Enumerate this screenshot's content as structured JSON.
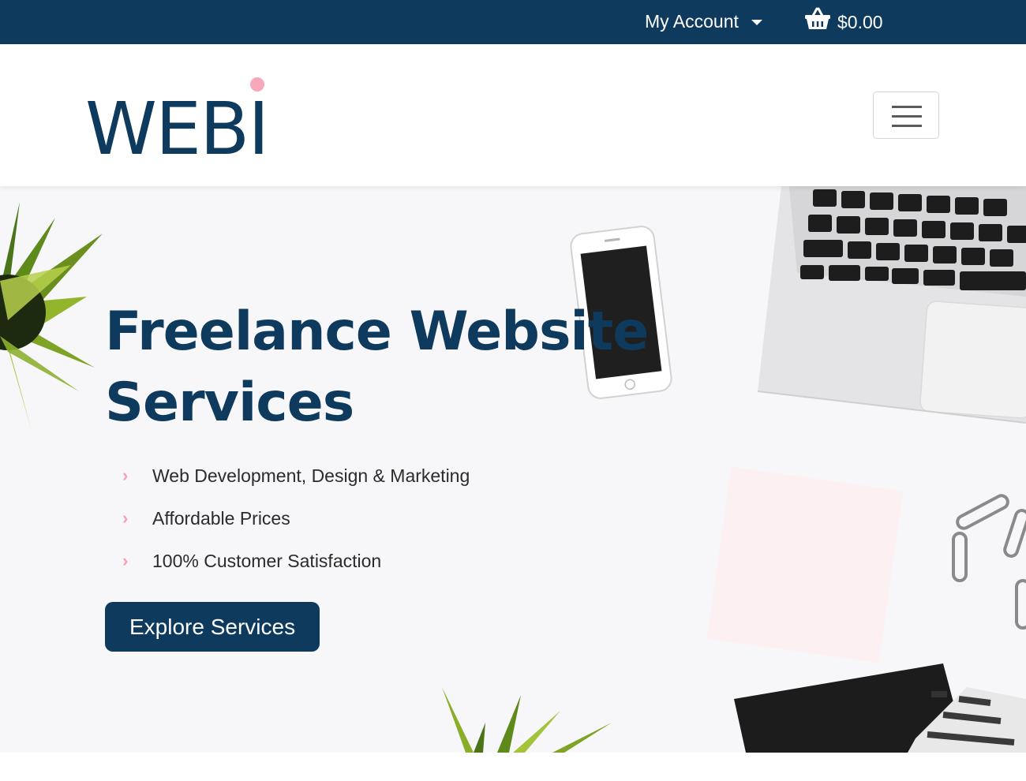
{
  "topbar": {
    "account_label": "My Account",
    "cart_total": "$0.00"
  },
  "header": {
    "logo_text": "WEBI"
  },
  "hero": {
    "title": "Freelance Website Services",
    "features": [
      "Web Development, Design & Marketing",
      "Affordable Prices",
      "100% Customer Satisfaction"
    ],
    "cta_label": "Explore Services"
  },
  "icons": {
    "account_dropdown": "chevron-down-icon",
    "cart": "basket-icon",
    "menu": "hamburger-icon",
    "feature_bullet": "chevron-right-icon"
  },
  "colors": {
    "brand_navy": "#0e3a5e",
    "accent_pink": "#f4a0b4",
    "hero_background": "#f7f7f9"
  }
}
